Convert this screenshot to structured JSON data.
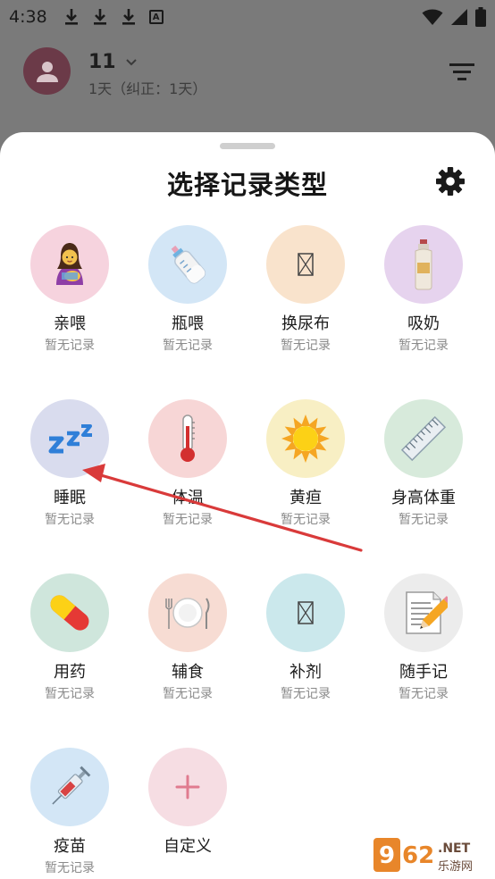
{
  "status_bar": {
    "time": "4:38",
    "a_badge": "A"
  },
  "header": {
    "baby_name": "11",
    "baby_age": "1天（纠正：1天）"
  },
  "sheet": {
    "title": "选择记录类型"
  },
  "record_types": [
    {
      "label": "亲喂",
      "sub": "暂无记录",
      "icon": "breastfeeding-icon",
      "bg": "#f6d3de"
    },
    {
      "label": "瓶喂",
      "sub": "暂无记录",
      "icon": "baby-bottle-icon",
      "bg": "#d3e6f6"
    },
    {
      "label": "换尿布",
      "sub": "暂无记录",
      "icon": "diaper-icon",
      "bg": "#f9e3cc"
    },
    {
      "label": "吸奶",
      "sub": "暂无记录",
      "icon": "breast-pump-icon",
      "bg": "#e6d3ee"
    },
    {
      "label": "睡眠",
      "sub": "暂无记录",
      "icon": "sleep-zzz-icon",
      "bg": "#d9dcee"
    },
    {
      "label": "体温",
      "sub": "暂无记录",
      "icon": "thermometer-icon",
      "bg": "#f7d6d6"
    },
    {
      "label": "黄疸",
      "sub": "暂无记录",
      "icon": "sun-icon",
      "bg": "#f8efc4"
    },
    {
      "label": "身高体重",
      "sub": "暂无记录",
      "icon": "ruler-icon",
      "bg": "#d7eadb"
    },
    {
      "label": "用药",
      "sub": "暂无记录",
      "icon": "pill-icon",
      "bg": "#cfe6dc"
    },
    {
      "label": "辅食",
      "sub": "暂无记录",
      "icon": "plate-utensils-icon",
      "bg": "#f7dcd3"
    },
    {
      "label": "补剂",
      "sub": "暂无记录",
      "icon": "supplement-icon",
      "bg": "#cbe8ec"
    },
    {
      "label": "随手记",
      "sub": "暂无记录",
      "icon": "memo-pencil-icon",
      "bg": "#ececec"
    },
    {
      "label": "疫苗",
      "sub": "暂无记录",
      "icon": "syringe-icon",
      "bg": "#d3e6f6"
    },
    {
      "label": "自定义",
      "sub": "",
      "icon": "plus-icon",
      "bg": "#f6dde3"
    }
  ],
  "colors": {
    "accent_red": "#d93a3a",
    "scrim": "#7a7a7a",
    "sheet_bg": "#ffffff"
  },
  "watermark": {
    "brand": "962.NET",
    "site": "乐游网"
  }
}
